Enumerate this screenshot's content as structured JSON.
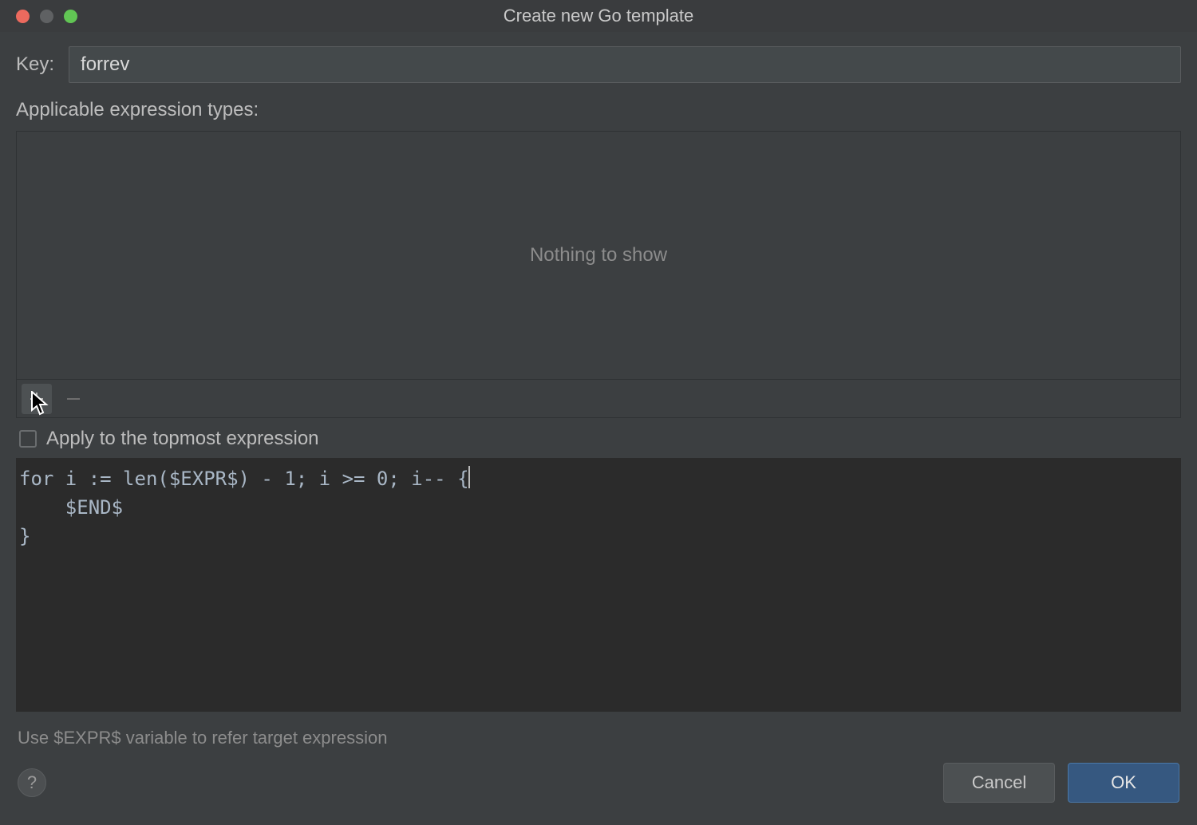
{
  "window": {
    "title": "Create new Go template"
  },
  "form": {
    "key_label": "Key:",
    "key_value": "forrev",
    "applicable_label": "Applicable expression types:",
    "list_empty_text": "Nothing to show",
    "apply_topmost_label": "Apply to the topmost expression",
    "apply_topmost_checked": false,
    "template_body": "for i := len($EXPR$) - 1; i >= 0; i-- {\n    $END$\n}",
    "hint": "Use $EXPR$ variable to refer target expression"
  },
  "buttons": {
    "help": "?",
    "cancel": "Cancel",
    "ok": "OK"
  },
  "icons": {
    "add": "plus-icon",
    "remove": "minus-icon"
  }
}
